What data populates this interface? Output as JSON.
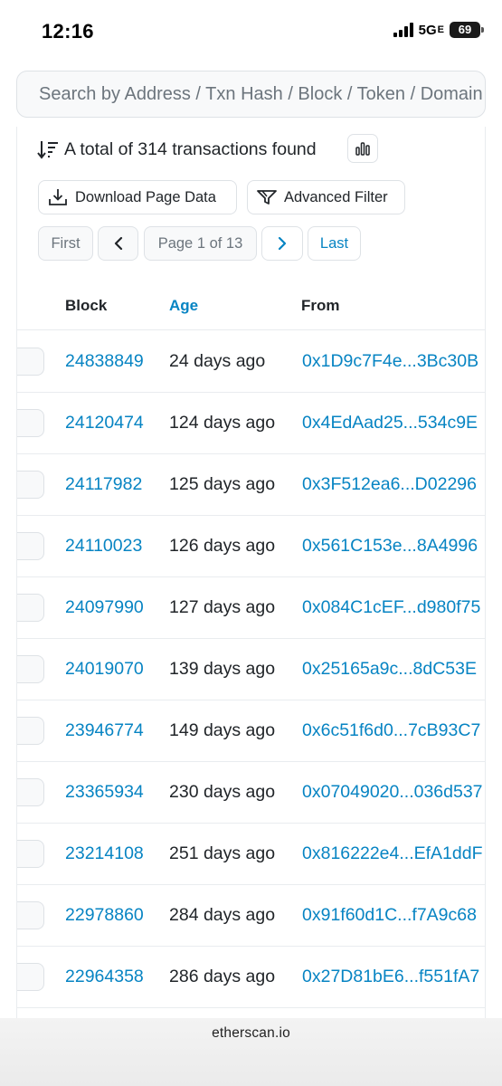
{
  "status_bar": {
    "time": "12:16",
    "network": "5G",
    "network_suffix": "E",
    "battery": "69"
  },
  "search": {
    "placeholder": "Search by Address / Txn Hash / Block / Token / Domain Name"
  },
  "summary": {
    "text": "A total of 314 transactions found"
  },
  "toolbar": {
    "download_label": "Download Page Data",
    "filter_label": "Advanced Filter"
  },
  "pagination": {
    "first": "First",
    "page": "Page 1 of 13",
    "last": "Last"
  },
  "table": {
    "columns": [
      "Block",
      "Age",
      "From"
    ],
    "rows": [
      {
        "block": "24838849",
        "age": "24 days ago",
        "from": "0x1D9c7F4e...3Bc30B"
      },
      {
        "block": "24120474",
        "age": "124 days ago",
        "from": "0x4EdAad25...534c9E"
      },
      {
        "block": "24117982",
        "age": "125 days ago",
        "from": "0x3F512ea6...D02296"
      },
      {
        "block": "24110023",
        "age": "126 days ago",
        "from": "0x561C153e...8A4996"
      },
      {
        "block": "24097990",
        "age": "127 days ago",
        "from": "0x084C1cEF...d980f75"
      },
      {
        "block": "24019070",
        "age": "139 days ago",
        "from": "0x25165a9c...8dC53E"
      },
      {
        "block": "23946774",
        "age": "149 days ago",
        "from": "0x6c51f6d0...7cB93C7"
      },
      {
        "block": "23365934",
        "age": "230 days ago",
        "from": "0x07049020...036d537"
      },
      {
        "block": "23214108",
        "age": "251 days ago",
        "from": "0x816222e4...EfA1ddF"
      },
      {
        "block": "22978860",
        "age": "284 days ago",
        "from": "0x91f60d1C...f7A9c68"
      },
      {
        "block": "22964358",
        "age": "286 days ago",
        "from": "0x27D81bE6...f551fA7"
      }
    ]
  },
  "footer": {
    "domain": "etherscan.io"
  },
  "colors": {
    "link": "#0784c3",
    "text": "#212529",
    "muted": "#6c757d",
    "border": "#dee2e6"
  }
}
